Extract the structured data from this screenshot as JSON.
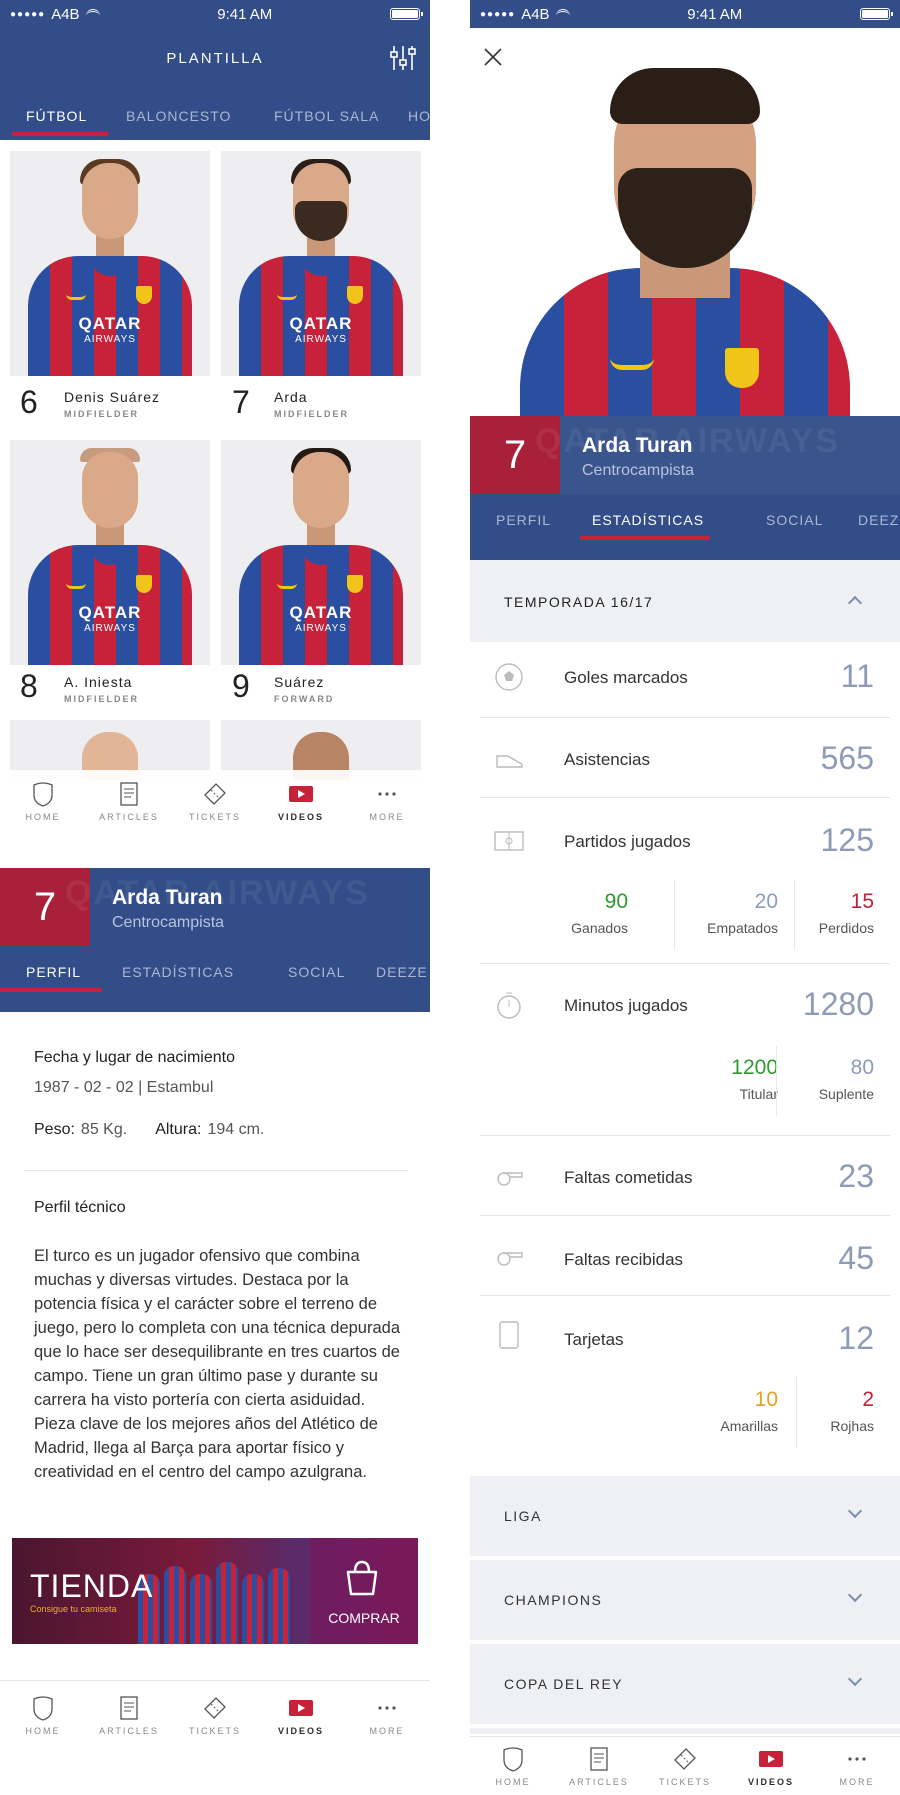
{
  "status_bar": {
    "carrier": "A4B",
    "time": "9:41 AM"
  },
  "roster": {
    "title": "PLANTILLA",
    "tabs": [
      "FÚTBOL",
      "BALONCESTO",
      "FÚTBOL SALA",
      "HO"
    ],
    "players": [
      {
        "number": "6",
        "name": "Denis Suárez",
        "position": "MIDFIELDER"
      },
      {
        "number": "7",
        "name": "Arda",
        "position": "MIDFIELDER"
      },
      {
        "number": "8",
        "name": "A. Iniesta",
        "position": "MIDFIELDER"
      },
      {
        "number": "9",
        "name": "Suárez",
        "position": "FORWARD"
      }
    ]
  },
  "tabbar": {
    "items": [
      {
        "label": "HOME",
        "icon": "crest-icon"
      },
      {
        "label": "ARTICLES",
        "icon": "document-icon"
      },
      {
        "label": "TICKETS",
        "icon": "ticket-icon"
      },
      {
        "label": "VIDEOS",
        "icon": "play-icon",
        "active": true
      },
      {
        "label": "MORE",
        "icon": "more-icon"
      }
    ]
  },
  "player": {
    "number": "7",
    "name": "Arda Turan",
    "role": "Centrocampista",
    "watermark": "QATAR AIRWAYS",
    "tabs": [
      "PERFIL",
      "ESTADÍSTICAS",
      "SOCIAL",
      "DEEZE"
    ]
  },
  "profile": {
    "birth_label": "Fecha y lugar de nacimiento",
    "birth_value": "1987 - 02 - 02 | Estambul",
    "weight_label": "Peso:",
    "weight_value": "85 Kg.",
    "height_label": "Altura:",
    "height_value": "194 cm.",
    "technical_label": "Perfil técnico",
    "technical_text": "El turco es un jugador ofensivo que combina muchas y diversas virtudes. Destaca por la potencia física y el carácter sobre el terreno de juego, pero lo completa con una técnica depurada que lo hace ser desequilibrante en tres cuartos de campo. Tiene un gran último pase y durante su carrera ha visto portería con cierta asiduidad. Pieza clave de los mejores años del Atlético de Madrid, llega al Barça para aportar físico y creatividad en el centro del campo azulgrana.",
    "shop": {
      "title": "TIENDA",
      "subtitle": "Consigue tu camiseta",
      "cta": "COMPRAR"
    }
  },
  "stats": {
    "season_label": "TEMPORADA 16/17",
    "rows": [
      {
        "label": "Goles marcados",
        "value": "11",
        "icon": "ball-icon"
      },
      {
        "label": "Asistencias",
        "value": "565",
        "icon": "boot-icon"
      },
      {
        "label": "Partidos jugados",
        "value": "125",
        "icon": "pitch-icon",
        "sub": [
          {
            "value": "90",
            "label": "Ganados"
          },
          {
            "value": "20",
            "label": "Empatados"
          },
          {
            "value": "15",
            "label": "Perdidos"
          }
        ]
      },
      {
        "label": "Minutos jugados",
        "value": "1280",
        "icon": "stopwatch-icon",
        "sub": [
          {
            "value": "1200",
            "label": "Titular"
          },
          {
            "value": "80",
            "label": "Suplente"
          }
        ]
      },
      {
        "label": "Faltas cometidas",
        "value": "23",
        "icon": "whistle-icon"
      },
      {
        "label": "Faltas recibidas",
        "value": "45",
        "icon": "whistle-icon"
      },
      {
        "label": "Tarjetas",
        "value": "12",
        "icon": "card-icon",
        "sub": [
          {
            "value": "10",
            "label": "Amarillas"
          },
          {
            "value": "2",
            "label": "Rojhas"
          }
        ]
      }
    ],
    "competitions": [
      "LIGA",
      "CHAMPIONS",
      "COPA DEL REY"
    ]
  },
  "colors": {
    "brand_blue": "#324d87",
    "brand_red": "#a8203a",
    "win": "#2e9a2e",
    "loss": "#c0213a",
    "yellow": "#e6a21a",
    "neutral": "#8e9bb7"
  }
}
